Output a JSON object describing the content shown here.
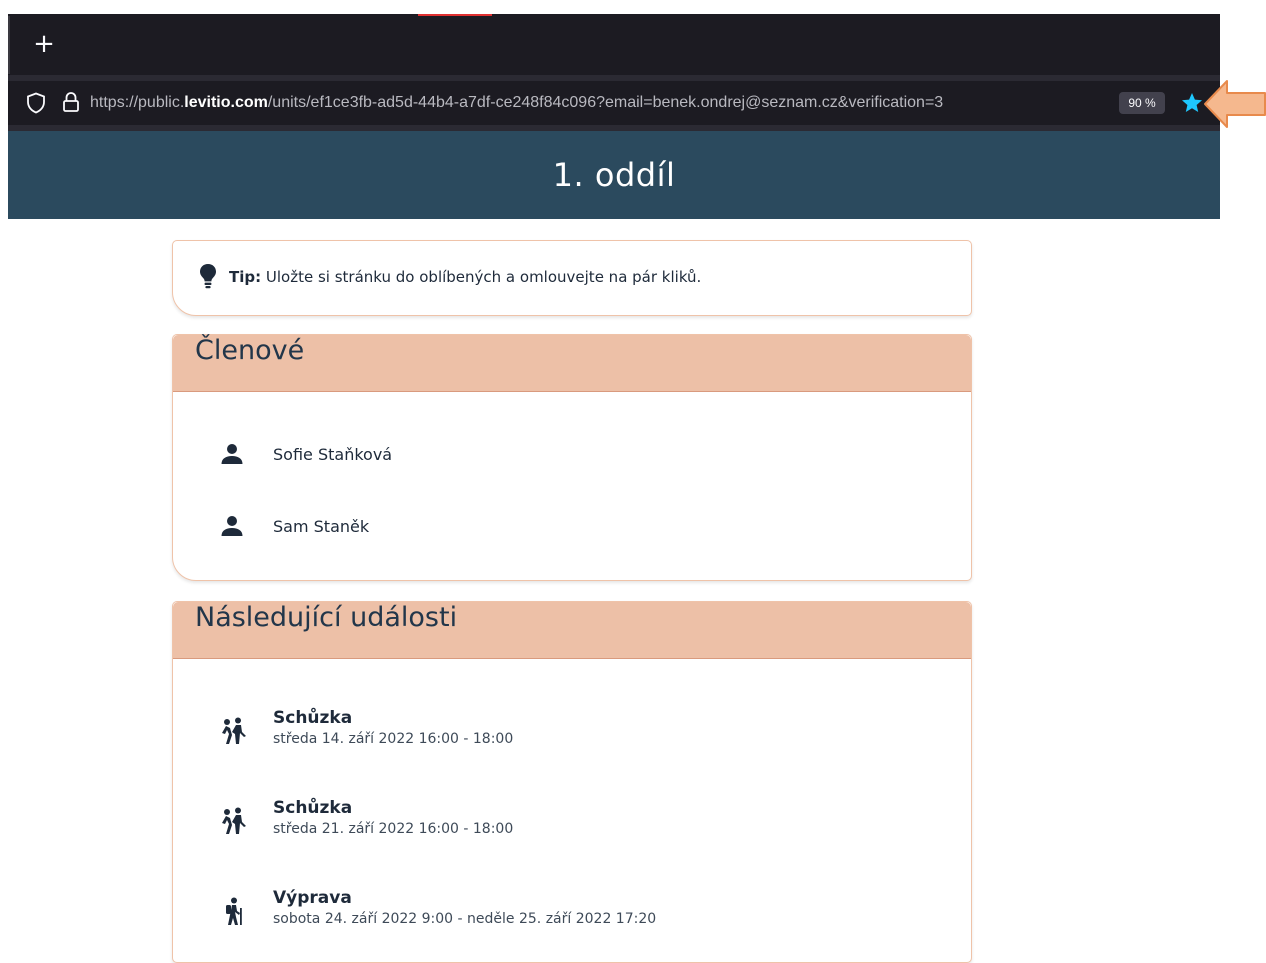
{
  "browser": {
    "newtab_label": "+",
    "url_prefix": "https://public.",
    "url_domain": "levitio.com",
    "url_rest": "/units/ef1ce3fb-ad5d-44b4-a7df-ce248f84c096?email=benek.ondrej@seznam.cz&verification=3",
    "zoom": "90 %",
    "accent_color": "#1ec8ff"
  },
  "header": {
    "title": "1. oddíl",
    "bg_color": "#2b4a5e"
  },
  "tip": {
    "label": "Tip:",
    "text": "Uložte si stránku do oblíbených a omlouvejte na pár kliků."
  },
  "members": {
    "title": "Členové",
    "items": [
      {
        "name": "Sofie Staňková",
        "icon": "person-icon"
      },
      {
        "name": "Sam Staněk",
        "icon": "person-icon"
      }
    ]
  },
  "events": {
    "title": "Následující události",
    "items": [
      {
        "title": "Schůzka",
        "date": "středa 14. září 2022 16:00 - 18:00",
        "icon": "meeting-icon"
      },
      {
        "title": "Schůzka",
        "date": "středa 21. září 2022 16:00 - 18:00",
        "icon": "meeting-icon"
      },
      {
        "title": "Výprava",
        "date": "sobota 24. září 2022 9:00 - neděle 25. září 2022 17:20",
        "icon": "hiking-icon"
      }
    ]
  }
}
